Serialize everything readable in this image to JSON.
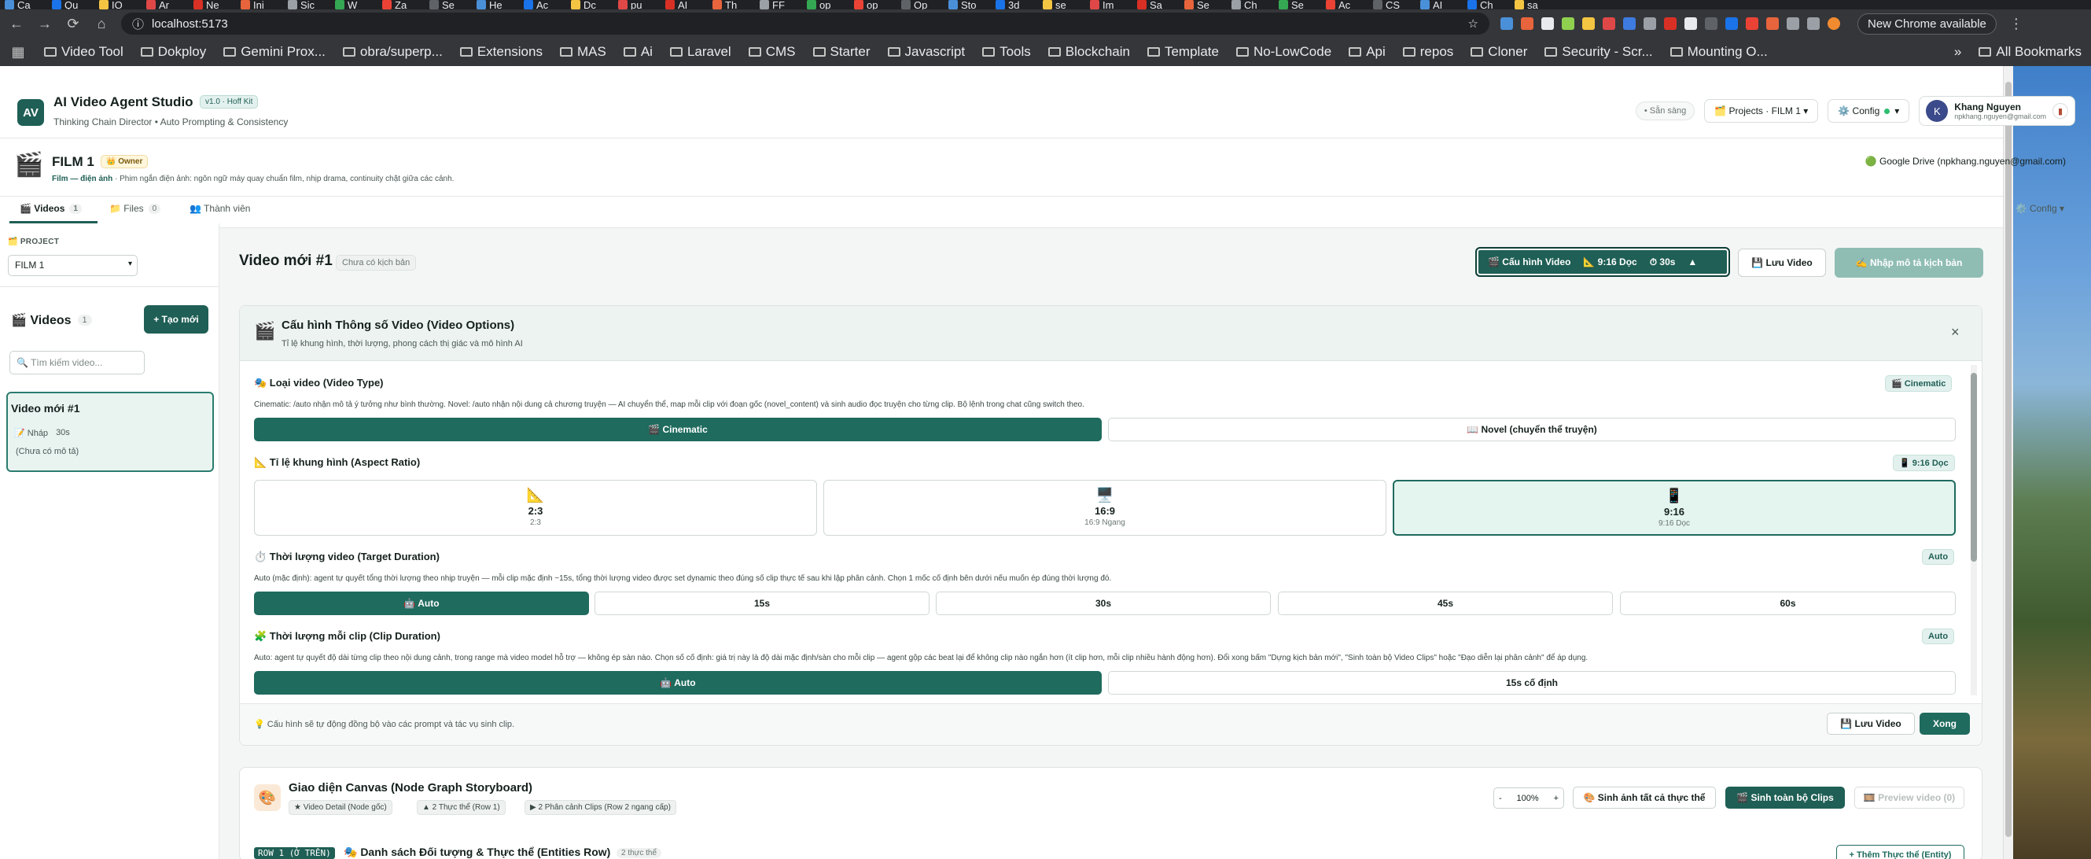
{
  "browser": {
    "tabs": [
      "Ca",
      "Qu",
      "IO",
      "Ar",
      "Ne",
      "Ini",
      "Sic",
      "W",
      "Za",
      "Se",
      "He",
      "Ac",
      "Dc",
      "pu",
      "AI",
      "Th",
      "FF",
      "op",
      "op",
      "Op",
      "Sto",
      "3d",
      "se",
      "Im",
      "Sa",
      "Se",
      "Ch",
      "Se",
      "Ac",
      "CS",
      "AI",
      "Ch",
      "sa"
    ],
    "url": "localhost:5173",
    "new_chrome": "New Chrome available",
    "bookmarks": [
      "Video Tool",
      "Dokploy",
      "Gemini Prox...",
      "obra/superp...",
      "Extensions",
      "MAS",
      "Ai",
      "Laravel",
      "CMS",
      "Starter",
      "Javascript",
      "Tools",
      "Blockchain",
      "Template",
      "No-LowCode",
      "Api",
      "repos",
      "Cloner",
      "Security - Scr...",
      "Mounting O..."
    ],
    "all_bookmarks": "All Bookmarks"
  },
  "app": {
    "logo": "AV",
    "title": "AI Video Agent Studio",
    "version": "v1.0 · Hoff Kit",
    "subtitle": "Thinking Chain Director • Auto Prompting & Consistency",
    "status": "• Sẵn sàng",
    "projects_btn": "🗂️ Projects · FILM 1 ▾",
    "config_btn": "⚙️ Config",
    "user_name": "Khang Nguyen",
    "user_email": "npkhang.nguyen@gmail.com",
    "avatar": "K"
  },
  "project": {
    "name": "FILM 1",
    "owner_badge": "👑 Owner",
    "desc_type": "Film — điện ảnh",
    "desc_rest": " · Phim ngắn điện ảnh: ngôn ngữ máy quay chuẩn film, nhịp drama, continuity chặt giữa các cảnh.",
    "gdrive": "🟢 Google Drive (npkhang.nguyen@gmail.com)",
    "tabs": [
      {
        "label": "🎬 Videos",
        "count": "1"
      },
      {
        "label": "📁 Files",
        "count": "0"
      },
      {
        "label": "👥 Thành viên",
        "count": ""
      }
    ],
    "config_tab": "⚙️ Config ▾"
  },
  "sidebar": {
    "project_label": "🗂️ PROJECT",
    "project_value": "FILM 1",
    "videos_label": "🎬 Videos",
    "videos_count": "1",
    "new_btn": "+ Tạo mới",
    "search_placeholder": "🔍 Tìm kiếm video...",
    "video_card": {
      "title": "Video mới #1",
      "status": "📝 Nháp",
      "duration": "30s",
      "desc": "(Chưa có mô tả)"
    }
  },
  "main": {
    "title": "Video mới #1",
    "badge": "Chưa có kịch bản",
    "config_btn": {
      "label": "🎬 Cấu hình Video",
      "ratio": "📐 9:16 Dọc",
      "duration": "⏱ 30s",
      "chev": "▲"
    },
    "save_btn": "💾 Lưu Video",
    "import_btn": "✍️ Nhập mô tả kịch bản"
  },
  "options": {
    "icon": "🎬",
    "title": "Cấu hình Thông số Video (Video Options)",
    "subtitle": "Tỉ lệ khung hình, thời lượng, phong cách thị giác và mô hình AI",
    "close": "×",
    "video_type": {
      "title": "🎭 Loại video (Video Type)",
      "tag": "🎬 Cinematic",
      "desc": "Cinematic: /auto nhận mô tả ý tưởng như bình thường. Novel: /auto nhận nội dung cả chương truyện — AI chuyển thể, map mỗi clip với đoạn gốc (novel_content) và sinh audio đọc truyện cho từng clip. Bộ lệnh trong chat cũng switch theo.",
      "options": [
        "🎬 Cinematic",
        "📖 Novel (chuyển thể truyện)"
      ],
      "selected": 0
    },
    "aspect": {
      "title": "📐 Tỉ lệ khung hình (Aspect Ratio)",
      "tag": "📱 9:16 Dọc",
      "cards": [
        {
          "icon": "📐",
          "label": "2:3",
          "sub": "2:3"
        },
        {
          "icon": "🖥️",
          "label": "16:9",
          "sub": "16:9 Ngang"
        },
        {
          "icon": "📱",
          "label": "9:16",
          "sub": "9:16 Dọc"
        }
      ],
      "selected": 2
    },
    "target_duration": {
      "title": "⏱️ Thời lượng video (Target Duration)",
      "tag": "Auto",
      "desc": "Auto (mặc định): agent tự quyết tổng thời lượng theo nhịp truyện — mỗi clip mặc định ~15s, tổng thời lượng video được set dynamic theo đúng số clip thực tế sau khi lập phân cảnh. Chọn 1 mốc cố định bên dưới nếu muốn ép đúng thời lượng đó.",
      "options": [
        "🤖 Auto",
        "15s",
        "30s",
        "45s",
        "60s"
      ],
      "selected": 0
    },
    "clip_duration": {
      "title": "🧩 Thời lượng mỗi clip (Clip Duration)",
      "tag": "Auto",
      "desc": "Auto: agent tự quyết độ dài từng clip theo nội dung cảnh, trong range mà video model hỗ trợ — không ép sàn nào. Chọn số cố định: giá trị này là độ dài mặc định/sàn cho mỗi clip — agent gộp các beat lại để không clip nào ngắn hơn (ít clip hơn, mỗi clip nhiều hành động hơn). Đổi xong bấm \"Dựng kịch bản mới\", \"Sinh toàn bộ Video Clips\" hoặc \"Đạo diễn lại phân cảnh\" để áp dụng.",
      "options": [
        "🤖 Auto",
        "15s cố định"
      ],
      "selected": 0
    },
    "footer_note": "💡 Cấu hình sẽ tự động đồng bộ vào các prompt và tác vụ sinh clip.",
    "footer_save": "💾 Lưu Video",
    "footer_done": "Xong"
  },
  "canvas": {
    "icon": "🎨",
    "title": "Giao diện Canvas (Node Graph Storyboard)",
    "chips": [
      "★ Video Detail (Node gốc)",
      "▲ 2 Thực thể (Row 1)",
      "▶ 2 Phân cảnh Clips (Row 2 ngang cấp)"
    ],
    "zoom_minus": "-",
    "zoom": "100%",
    "zoom_plus": "+",
    "gen_images": "🎨 Sinh ảnh tất cả thực thể",
    "gen_clips": "🎬 Sinh toàn bộ Clips",
    "preview": "🎞️ Preview video (0)",
    "row_label": "ROW 1 (Ở TRÊN)",
    "row_title": "🎭 Danh sách Đối tượng & Thực thể (Entities Row)",
    "row_count": "2 thực thể",
    "add_entity": "+ Thêm Thực thể (Entity)"
  },
  "colors": {
    "primary": "#1f5f55",
    "primary_active": "#1f6b5e",
    "selected_bg": "#e4f4ef",
    "muted_btn": "#8fbdb4"
  }
}
